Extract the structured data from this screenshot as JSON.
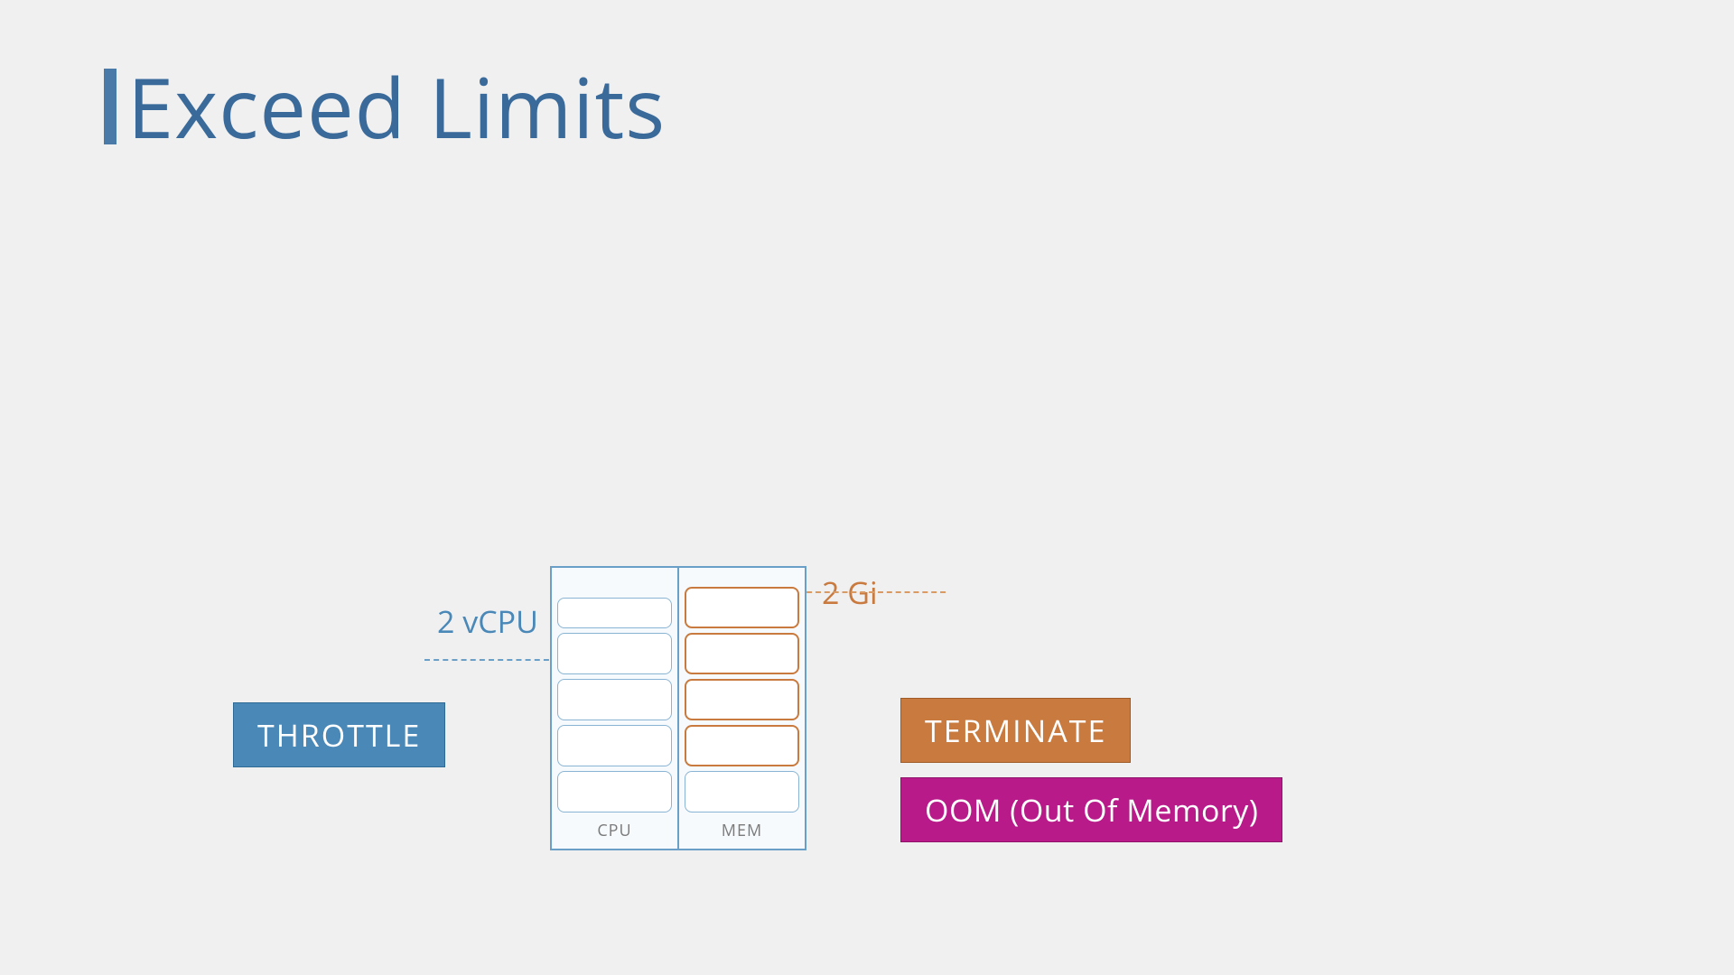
{
  "title": "Exceed Limits",
  "limits": {
    "cpu_label": "2 vCPU",
    "mem_label": "2 Gi"
  },
  "badges": {
    "throttle": "THROTTLE",
    "terminate": "TERMINATE",
    "oom": "OOM (Out Of Memory)"
  },
  "container": {
    "cpu_footer": "CPU",
    "mem_footer": "MEM",
    "cpu_cells": 4,
    "cpu_top_half": true,
    "mem_cells_blue": 1,
    "mem_cells_orange": 4
  },
  "colors": {
    "blue": "#4a88b8",
    "orange": "#c97a3e",
    "magenta": "#b91a8a",
    "title": "#3a6a9a"
  }
}
